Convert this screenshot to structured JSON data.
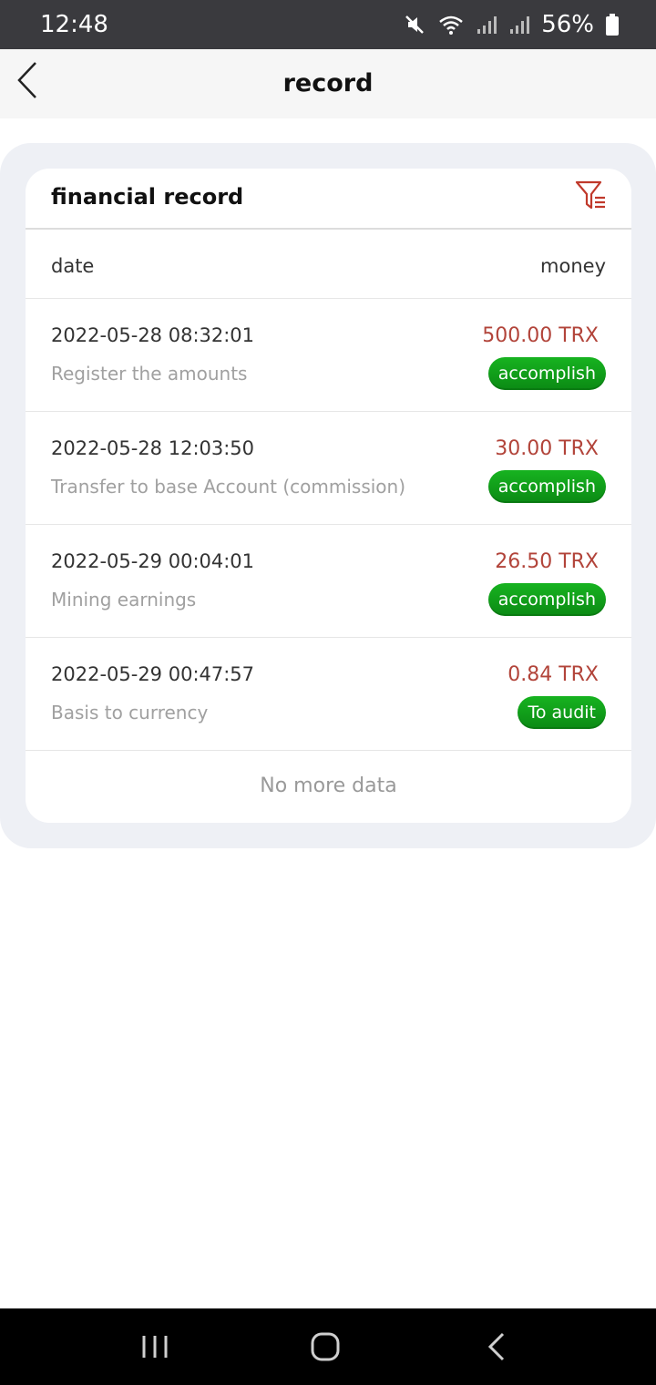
{
  "status_bar": {
    "time": "12:48",
    "battery": "56%",
    "icons": [
      "mute-icon",
      "wifi-icon",
      "signal-icon",
      "signal-icon",
      "battery-icon"
    ]
  },
  "header": {
    "title": "record",
    "back_icon": "chevron-left-icon"
  },
  "card": {
    "title": "financial record",
    "filter_icon": "filter-icon",
    "columns": {
      "date": "date",
      "money": "money"
    },
    "records": [
      {
        "date": "2022-05-28 08:32:01",
        "desc": "Register the amounts",
        "amount": "500.00 TRX",
        "status": "accomplish"
      },
      {
        "date": "2022-05-28 12:03:50",
        "desc": "Transfer to base Account (commission)",
        "amount": "30.00 TRX",
        "status": "accomplish"
      },
      {
        "date": "2022-05-29 00:04:01",
        "desc": "Mining earnings",
        "amount": "26.50 TRX",
        "status": "accomplish"
      },
      {
        "date": "2022-05-29 00:47:57",
        "desc": "Basis to currency",
        "amount": "0.84 TRX",
        "status": "To audit"
      }
    ],
    "footer": "No more data"
  },
  "colors": {
    "amount": "#b2443a",
    "badge": "#0f9a18",
    "filter_icon": "#c0392b"
  }
}
